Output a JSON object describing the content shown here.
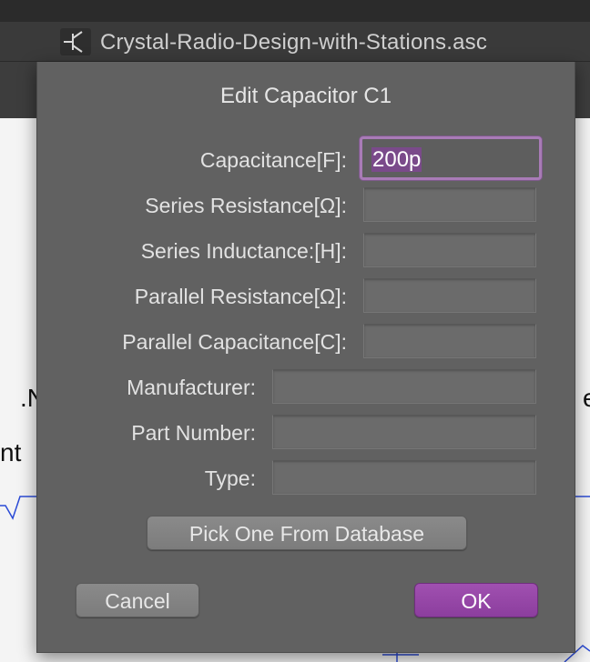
{
  "window": {
    "title": "Crystal-Radio-Design-with-Stations.asc",
    "icon": "transistor-icon"
  },
  "background": {
    "text_left_1": ".N",
    "text_left_2": "nt",
    "text_right": "e"
  },
  "dialog": {
    "title": "Edit Capacitor C1",
    "fields": [
      {
        "label": "Capacitance[F]:",
        "value": "200p"
      },
      {
        "label": "Series Resistance[Ω]:",
        "value": ""
      },
      {
        "label": "Series Inductance:[H]:",
        "value": ""
      },
      {
        "label": "Parallel Resistance[Ω]:",
        "value": ""
      },
      {
        "label": "Parallel Capacitance[C]:",
        "value": ""
      },
      {
        "label": "Manufacturer:",
        "value": ""
      },
      {
        "label": "Part Number:",
        "value": ""
      },
      {
        "label": "Type:",
        "value": ""
      }
    ],
    "pick_button": "Pick One From Database",
    "cancel_button": "Cancel",
    "ok_button": "OK"
  },
  "colors": {
    "accent": "#9b4aab",
    "wire": "#2b4bd6"
  }
}
